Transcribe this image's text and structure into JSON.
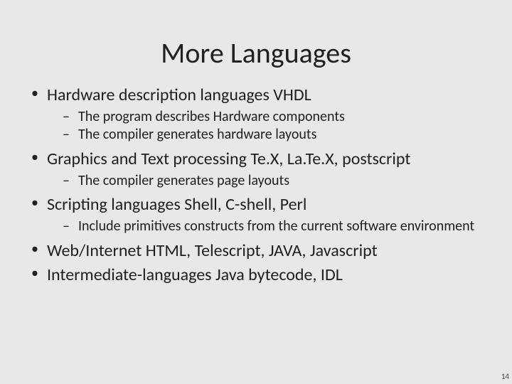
{
  "title": "More Languages",
  "items": [
    {
      "text": "Hardware description languages VHDL",
      "sub": [
        "The program describes Hardware components",
        "The compiler generates hardware layouts"
      ]
    },
    {
      "text": "Graphics and Text processing Te.X, La.Te.X,  postscript",
      "sub": [
        "The compiler generates page layouts"
      ]
    },
    {
      "text": "Scripting languages Shell, C-shell, Perl",
      "sub": [
        "Include primitives constructs from the current software environment"
      ]
    },
    {
      "text": "Web/Internet HTML, Telescript, JAVA, Javascript",
      "sub": []
    },
    {
      "text": "Intermediate-languages Java bytecode, IDL",
      "sub": []
    }
  ],
  "page_number": "14"
}
